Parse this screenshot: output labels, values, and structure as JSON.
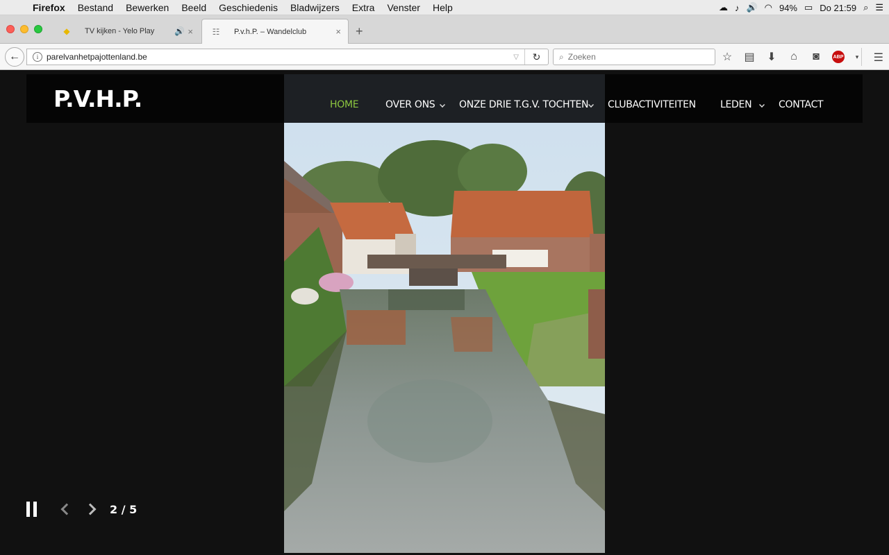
{
  "menubar": {
    "apple_icon": "apple-icon",
    "items": [
      "Firefox",
      "Bestand",
      "Bewerken",
      "Beeld",
      "Geschiedenis",
      "Bladwijzers",
      "Extra",
      "Venster",
      "Help"
    ],
    "battery": "94%",
    "clock": "Do 21:59"
  },
  "tabs": [
    {
      "title": "TV kijken - Yelo Play",
      "audio": true
    },
    {
      "title": "P.v.h.P. – Wandelclub",
      "active": true
    }
  ],
  "navbar": {
    "url": "parelvanhetpajottenland.be",
    "search_placeholder": "Zoeken",
    "abp_label": "ABP"
  },
  "site": {
    "logo": "P.V.H.P.",
    "menu": [
      {
        "label": "HOME",
        "active": true,
        "dropdown": false
      },
      {
        "label": "OVER ONS",
        "active": false,
        "dropdown": true
      },
      {
        "label": "ONZE DRIE T.G.V. TOCHTEN",
        "active": false,
        "dropdown": true
      },
      {
        "label": "CLUBACTIVITEITEN",
        "active": false,
        "dropdown": false
      },
      {
        "label": "LEDEN",
        "active": false,
        "dropdown": true
      },
      {
        "label": "CONTACT",
        "active": false,
        "dropdown": false
      }
    ],
    "accent_color": "#8cc63f"
  },
  "slider": {
    "counter": "2 / 5",
    "current": 2,
    "total": 5
  }
}
